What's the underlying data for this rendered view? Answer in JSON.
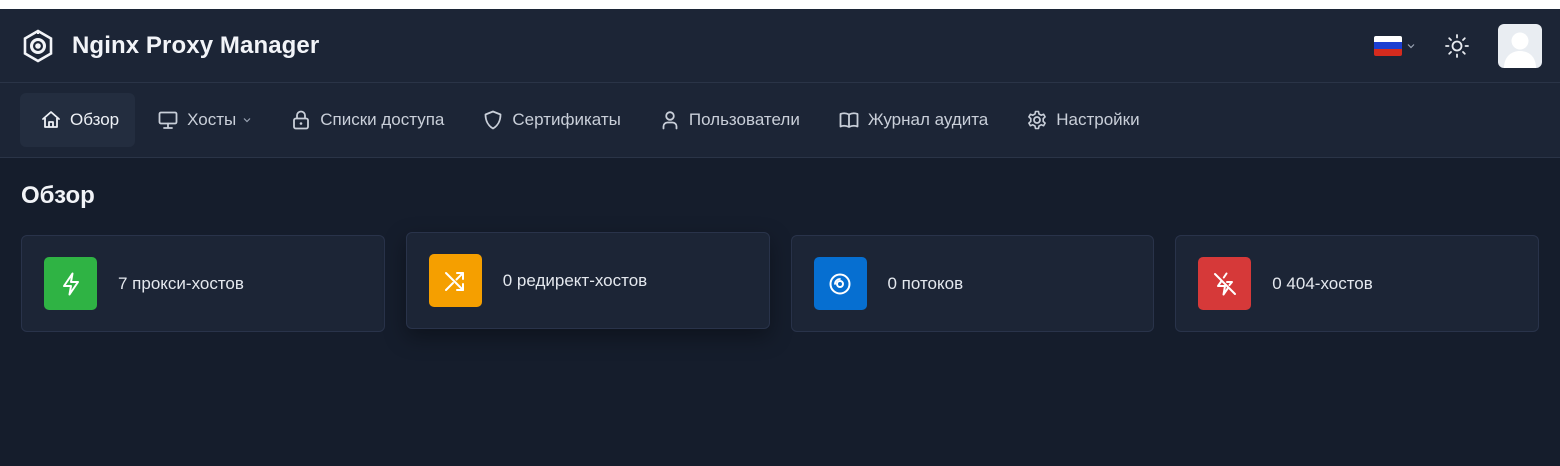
{
  "header": {
    "title": "Nginx Proxy Manager",
    "logo_icon": "nginx-logo-icon",
    "language_flag": "russia-flag-icon",
    "theme_icon": "sun-icon",
    "avatar_icon": "user-avatar-icon"
  },
  "nav": {
    "items": [
      {
        "label": "Обзор",
        "icon": "home-icon"
      },
      {
        "label": "Хосты",
        "icon": "monitor-icon"
      },
      {
        "label": "Списки доступа",
        "icon": "lock-icon"
      },
      {
        "label": "Сертификаты",
        "icon": "shield-icon"
      },
      {
        "label": "Пользователи",
        "icon": "user-icon"
      },
      {
        "label": "Журнал аудита",
        "icon": "book-icon"
      },
      {
        "label": "Настройки",
        "icon": "gear-icon"
      }
    ]
  },
  "main": {
    "title": "Обзор",
    "cards": [
      {
        "label": "7 прокси-хостов",
        "icon": "bolt-icon",
        "color": "#2fb344"
      },
      {
        "label": "0 редирект-хостов",
        "icon": "arrows-shuffle-icon",
        "color": "#f59f00"
      },
      {
        "label": "0 потоков",
        "icon": "disc-icon",
        "color": "#066fd1"
      },
      {
        "label": "0 404-хостов",
        "icon": "bolt-off-icon",
        "color": "#d63939"
      }
    ]
  },
  "colors": {
    "background": "#151d2c",
    "header": "#1c2536",
    "border": "#2a3447"
  }
}
